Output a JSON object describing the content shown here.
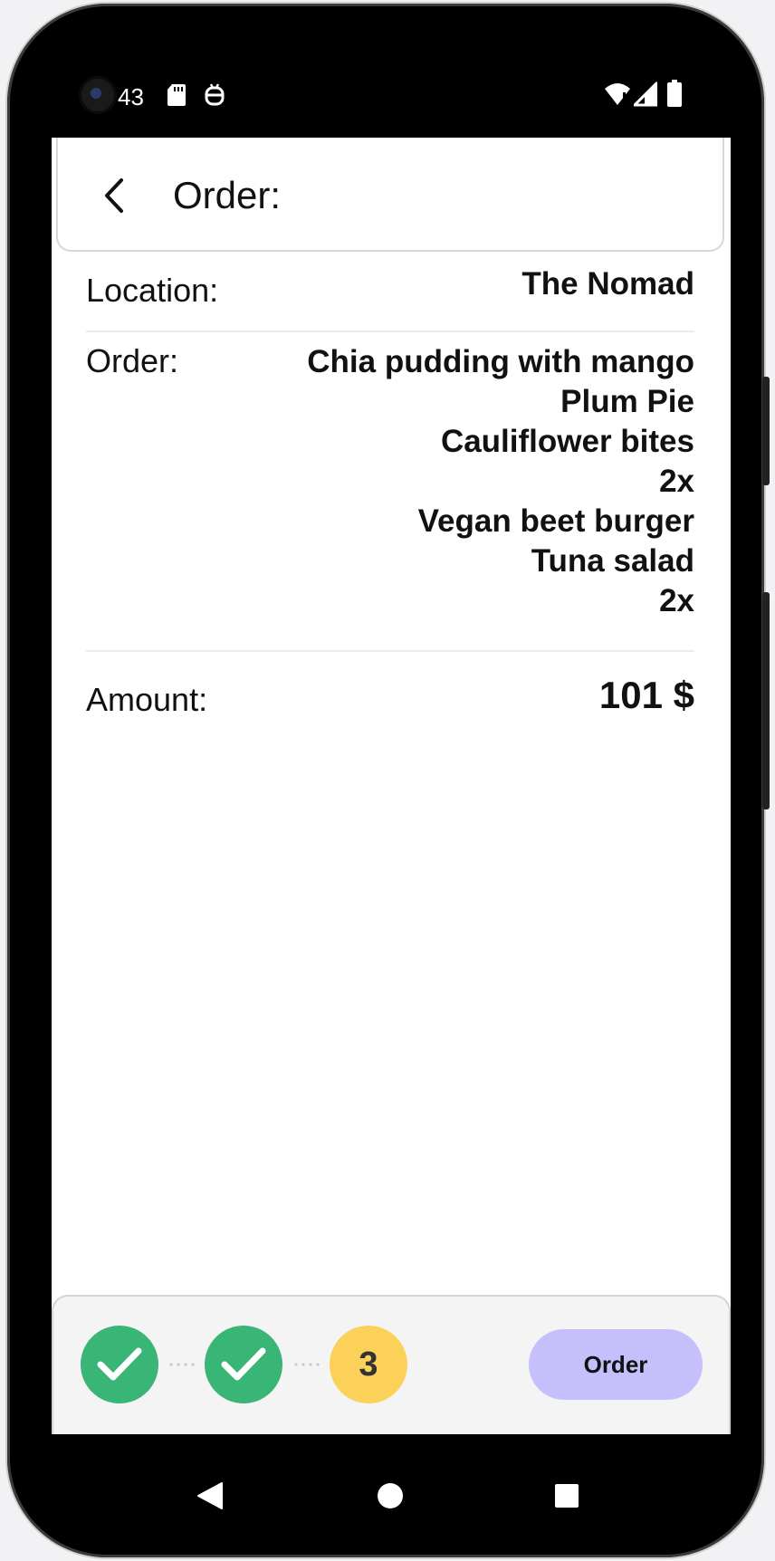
{
  "status_bar": {
    "time": "43",
    "left_icons": [
      "sd-card-icon",
      "debug-icon"
    ],
    "right_icons": [
      "wifi-icon",
      "signal-icon",
      "battery-icon"
    ]
  },
  "header": {
    "title": "Order:",
    "back_icon": "chevron-left-icon"
  },
  "details": {
    "location_label": "Location:",
    "location_value": "The Nomad",
    "order_label": "Order:",
    "order_items": [
      "Chia pudding with mango",
      "Plum Pie",
      "Cauliflower bites",
      "2x",
      "Vegan beet burger",
      "Tuna salad",
      "2x"
    ],
    "amount_label": "Amount:",
    "amount_value": "101 $"
  },
  "footer": {
    "steps": [
      {
        "state": "done",
        "icon": "check-icon"
      },
      {
        "state": "done",
        "icon": "check-icon"
      },
      {
        "state": "current",
        "number": "3"
      }
    ],
    "order_button_label": "Order"
  },
  "navbar": {
    "icons": [
      "back-triangle-icon",
      "home-circle-icon",
      "recents-square-icon"
    ]
  },
  "colors": {
    "step_done": "#39b575",
    "step_current": "#fcd15a",
    "order_button": "#c5c0fb"
  }
}
